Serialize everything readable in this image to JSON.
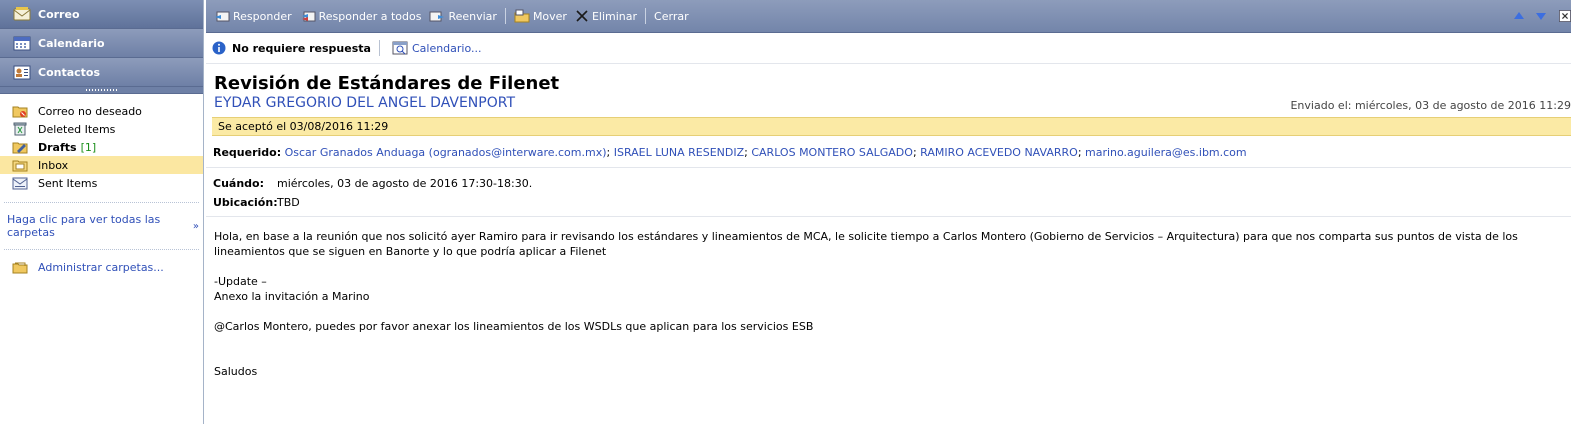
{
  "sidebar": {
    "nav": [
      {
        "label": "Correo",
        "icon": "mail-envelope-icon"
      },
      {
        "label": "Calendario",
        "icon": "calendar-icon"
      },
      {
        "label": "Contactos",
        "icon": "contact-card-icon"
      }
    ],
    "folders": [
      {
        "label": "Correo no deseado",
        "icon": "junk-folder-icon",
        "count": ""
      },
      {
        "label": "Deleted Items",
        "icon": "trash-icon",
        "count": ""
      },
      {
        "label": "Drafts",
        "icon": "drafts-icon",
        "count": "[1]"
      },
      {
        "label": "Inbox",
        "icon": "inbox-icon",
        "count": ""
      },
      {
        "label": "Sent Items",
        "icon": "sent-items-icon",
        "count": ""
      }
    ],
    "all_folders_link": "Haga clic para ver todas las carpetas",
    "admin_link": "Administrar carpetas..."
  },
  "toolbar": {
    "reply": "Responder",
    "reply_all": "Responder a todos",
    "forward": "Reenviar",
    "move": "Mover",
    "delete": "Eliminar",
    "close": "Cerrar"
  },
  "subbar": {
    "response": "No requiere respuesta",
    "calendar": "Calendario..."
  },
  "message": {
    "subject": "Revisión de Estándares de Filenet",
    "sender": "EYDAR GREGORIO DEL ANGEL DAVENPORT",
    "sent": "Enviado el: miércoles, 03 de agosto de 2016 11:29",
    "accepted": "Se aceptó el 03/08/2016 11:29",
    "required_label": "Requerido:",
    "required": [
      "Oscar Granados Anduaga (ogranados@interware.com.mx)",
      "ISRAEL LUNA RESENDIZ",
      "CARLOS MONTERO SALGADO",
      "RAMIRO ACEVEDO NAVARRO",
      "marino.aguilera@es.ibm.com"
    ],
    "when_label": "Cuándo:",
    "when": "miércoles, 03 de agosto de 2016 17:30-18:30.",
    "where_label": "Ubicación:",
    "where": "TBD",
    "body": [
      "Hola, en base a la reunión que nos solicitó ayer Ramiro para ir revisando los estándares y lineamientos de MCA, le solicite tiempo a Carlos Montero (Gobierno de Servicios – Arquitectura) para que nos comparta sus puntos de vista de los lineamientos que se siguen en Banorte y lo que podría aplicar a Filenet",
      "-Update –",
      "Anexo la invitación a Marino",
      "@Carlos Montero, puedes por favor anexar los lineamientos de los WSDLs que aplican para los servicios ESB",
      "Saludos"
    ]
  }
}
